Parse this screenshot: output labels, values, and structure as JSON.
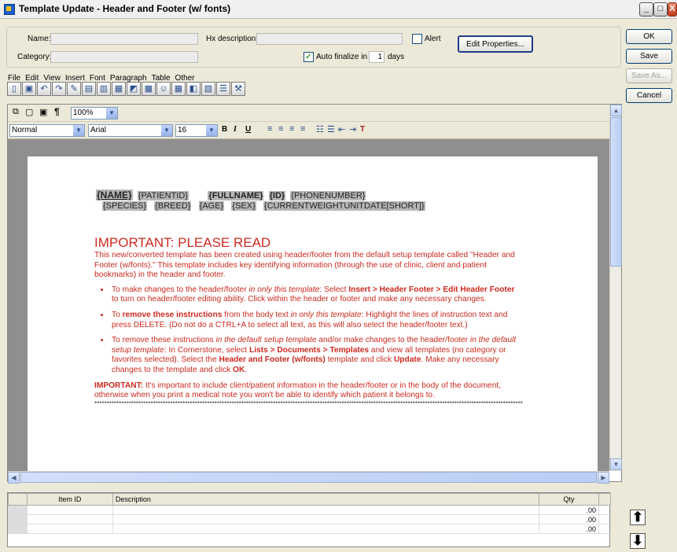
{
  "window": {
    "title": "Template Update - Header and Footer (w/ fonts)",
    "controls": [
      "_",
      "□",
      "X"
    ]
  },
  "fields": {
    "name_label": "Name:",
    "name_value": "",
    "category_label": "Category:",
    "category_value": "",
    "hx_label": "Hx description:",
    "hx_value": "",
    "alert_label": "Alert",
    "alert_checked": false,
    "auto_finalize_label": "Auto finalize in",
    "auto_finalize_checked": true,
    "auto_finalize_days": "1",
    "days_label": "days",
    "edit_properties": "Edit Properties..."
  },
  "side_buttons": {
    "ok": "OK",
    "save": "Save",
    "save_as": "Save As...",
    "cancel": "Cancel"
  },
  "menu": [
    "File",
    "Edit",
    "View",
    "Insert",
    "Font",
    "Paragraph",
    "Table",
    "Other"
  ],
  "toolbar_icons": [
    "preview-icon",
    "save-icon",
    "undo-icon",
    "redo-icon",
    "spell-icon",
    "template-icon",
    "paste-icon",
    "table-icon",
    "image-icon",
    "book-icon",
    "person-icon",
    "grid-icon",
    "chart-icon",
    "form-icon",
    "list-icon",
    "tools-icon"
  ],
  "editor": {
    "zoom": "100%",
    "style": "Normal",
    "font": "Arial",
    "size": "16",
    "fmt": {
      "bold": "B",
      "italic": "I",
      "underline": "U",
      "tx": "T"
    }
  },
  "document": {
    "header_line1": {
      "name": "{NAME}",
      "patientid": "{PATIENTID}",
      "fullname": "{FULLNAME}",
      "id": "{ID}",
      "phone": "{PHONENUMBER}"
    },
    "header_line2": {
      "species": "{SPECIES}",
      "breed": "{BREED}",
      "age": "{AGE}",
      "sex": "{SEX}",
      "weight": "{CURRENTWEIGHTUNITDATE[SHORT]}"
    },
    "heading": "IMPORTANT: PLEASE READ",
    "intro": "This new/converted template has been created using header/footer from the default setup template called \"Header and Footer (w/fonts).\" This template includes key identifying information (through the use of clinic, client and patient bookmarks) in the header and footer.",
    "b1": {
      "a": "To make changes to the header/footer ",
      "b": "in only this template",
      "c": ": Select ",
      "d": "Insert > Header Footer > Edit Header Footer",
      "e": " to turn on header/footer editing ability. Click within the header or footer and make any necessary changes."
    },
    "b2": {
      "a": "To ",
      "b": "remove these instructions",
      "c": " from the body text ",
      "d": "in only this template",
      "e": ": Highlight the lines of instruction text and press DELETE. (Do not do a CTRL+A to select all text, as this will also select the header/footer text.)"
    },
    "b3": {
      "a": "To remove these instructions ",
      "b": "in the default setup template",
      "c": " and/or make changes to the header/footer ",
      "d": "in the default setup template",
      "e": ": In Cornerstone, select ",
      "f": "Lists > Documents > Templates",
      "g": " and view all templates (no category or favorites selected). Select the ",
      "h": "Header and Footer (w/fonts)",
      "i": " template and click ",
      "j": "Update",
      "k": ". Make any necessary changes to the template and click ",
      "l": "OK",
      "m": "."
    },
    "imp_label": "IMPORTANT:",
    "imp_text": " It's important to include client/patient information in the header/footer or in the body of the document, otherwise when you print a medical note you won't be able to identify which patient it belongs to.",
    "stars": "****************************************************************************************************************************************************************************************************"
  },
  "grid": {
    "headers": {
      "item_id": "Item ID",
      "description": "Description",
      "qty": "Qty"
    },
    "rows": [
      {
        "item_id": "",
        "description": "",
        "qty": ".00"
      },
      {
        "item_id": "",
        "description": "",
        "qty": ".00"
      },
      {
        "item_id": "",
        "description": "",
        "qty": ".00"
      }
    ]
  }
}
